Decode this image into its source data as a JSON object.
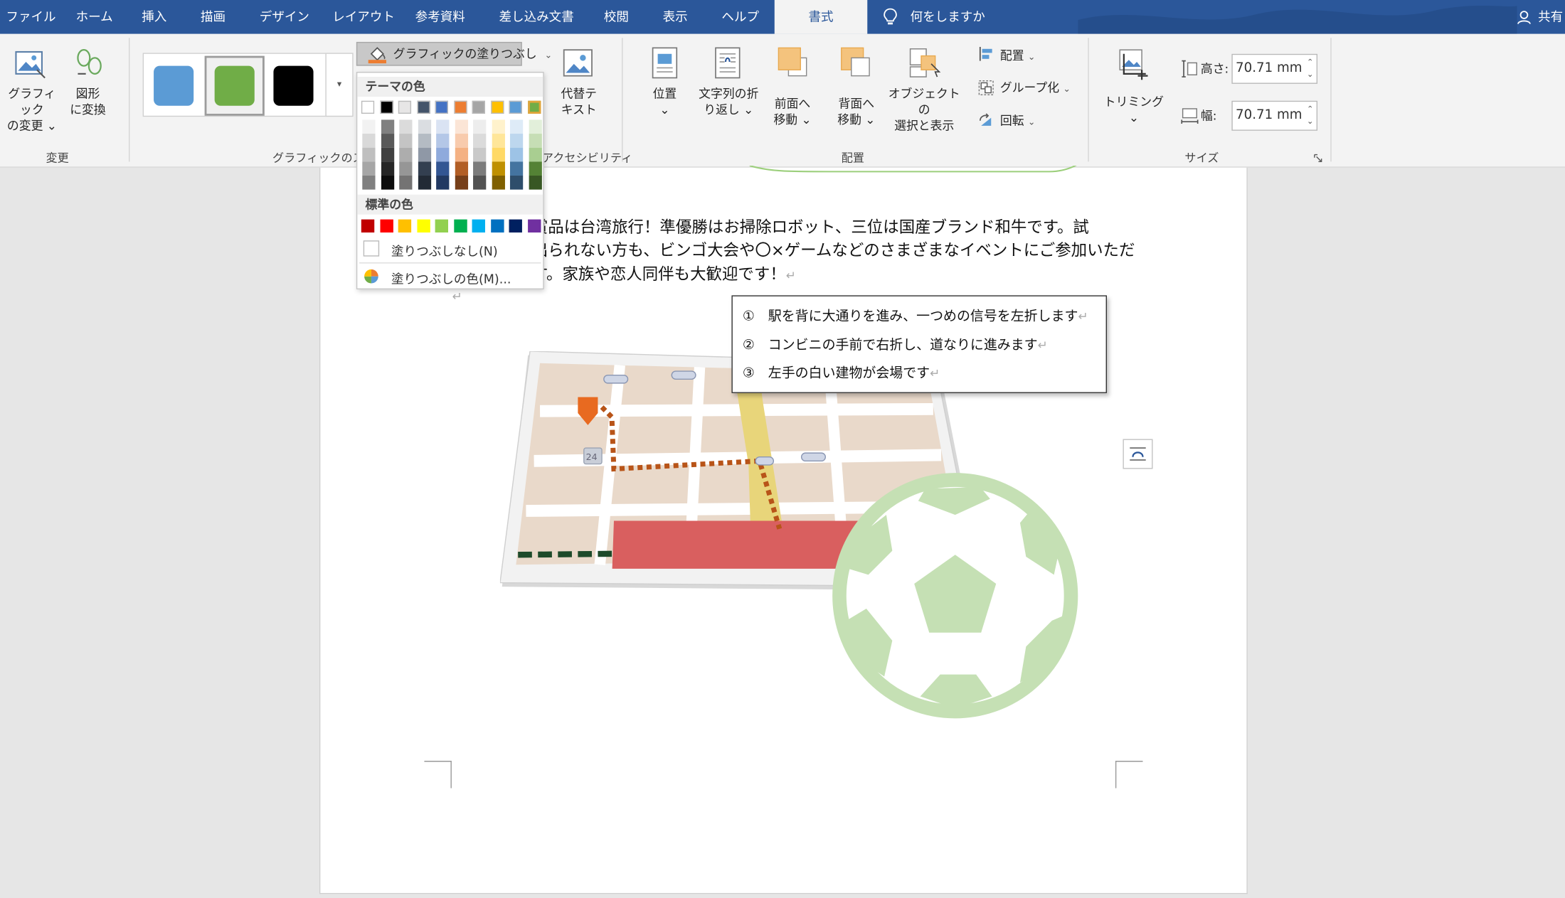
{
  "tabs": [
    {
      "label": "ファイル"
    },
    {
      "label": "ホーム"
    },
    {
      "label": "挿入"
    },
    {
      "label": "描画"
    },
    {
      "label": "デザイン"
    },
    {
      "label": "レイアウト"
    },
    {
      "label": "参考資料"
    },
    {
      "label": "差し込み文書"
    },
    {
      "label": "校閲"
    },
    {
      "label": "表示"
    },
    {
      "label": "ヘルプ"
    },
    {
      "label": "書式"
    }
  ],
  "tell_me": "何をしますか",
  "share": "共有",
  "ribbon": {
    "change_graphic": "グラフィック\nの変更 ⌄",
    "convert_shape": "図形\nに変換",
    "group_change": "変更",
    "fill_button": "グラフィックの塗りつぶし",
    "group_styles": "グラフィックのスタ",
    "alt_text": "代替テ\nキスト",
    "group_accessibility": "アクセシビリティ",
    "position": "位置\n⌄",
    "wrap_text": "文字列の折\nり返し ⌄",
    "bring_forward": "前面へ\n移動 ⌄",
    "send_backward": "背面へ\n移動 ⌄",
    "selection_pane": "オブジェクトの\n選択と表示",
    "align": "配置",
    "group": "グループ化",
    "rotate": "回転",
    "group_arrange": "配置",
    "crop": "トリミング\n⌄",
    "height_label": "高さ:",
    "height_value": "70.71 mm",
    "width_label": "幅:",
    "width_value": "70.71 mm",
    "group_size": "サイズ"
  },
  "style_swatches": [
    "#5b9bd5",
    "#70ad47",
    "#000000"
  ],
  "fill_menu": {
    "theme_colors_header": "テーマの色",
    "standard_colors_header": "標準の色",
    "no_fill": "塗りつぶしなし(N)",
    "more_colors": "塗りつぶしの色(M)...",
    "theme_colors": [
      "#ffffff",
      "#000000",
      "#e7e6e6",
      "#44546a",
      "#4472c4",
      "#ed7d31",
      "#a5a5a5",
      "#ffc000",
      "#5b9bd5",
      "#70ad47"
    ],
    "standard_colors": [
      "#c00000",
      "#ff0000",
      "#ffc000",
      "#ffff00",
      "#92d050",
      "#00b050",
      "#00b0f0",
      "#0070c0",
      "#002060",
      "#7030a0"
    ]
  },
  "document": {
    "line1": "優勝賞品は台湾旅行！準優勝はお掃除ロボット、三位は国産ブランド和牛です。試",
    "line2": "合に出られない方も、ビンゴ大会や〇×ゲームなどのさまざまなイベントにご参加いただ",
    "line3": "けます。家族や恋人同伴も大歓迎です！",
    "route": [
      "①　駅を背に大通りを進み、一つめの信号を左折します",
      "②　コンビニの手前で右折し、道なりに進みます",
      "③　左手の白い建物が会場です"
    ],
    "map_sign": "24"
  }
}
